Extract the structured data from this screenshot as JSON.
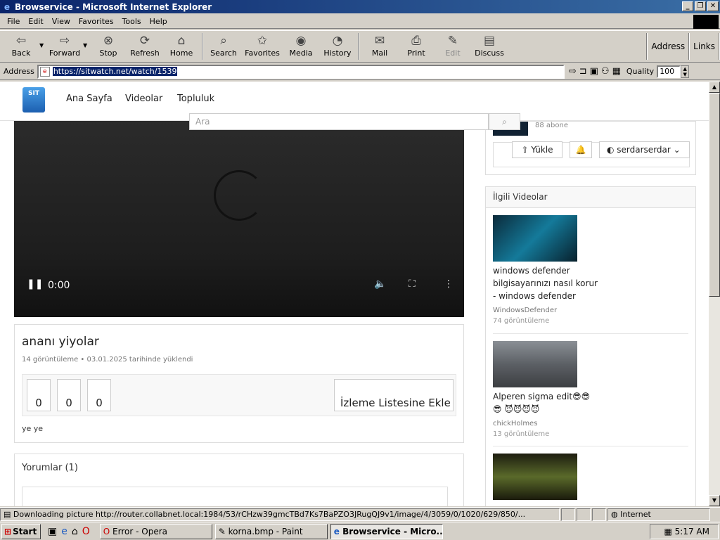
{
  "window": {
    "title": "Browservice - Microsoft Internet Explorer"
  },
  "menu": [
    "File",
    "Edit",
    "View",
    "Favorites",
    "Tools",
    "Help"
  ],
  "toolbar": {
    "back": "Back",
    "forward": "Forward",
    "stop": "Stop",
    "refresh": "Refresh",
    "home": "Home",
    "search": "Search",
    "favorites": "Favorites",
    "media": "Media",
    "history": "History",
    "mail": "Mail",
    "print": "Print",
    "edit": "Edit",
    "discuss": "Discuss",
    "address": "Address",
    "links": "Links"
  },
  "addressbar": {
    "label": "Address",
    "url": "https://sitwatch.net/watch/1539",
    "quality_label": "Quality",
    "quality_value": "100"
  },
  "site": {
    "logo": "SIT",
    "nav": [
      "Ana Sayfa",
      "Videolar",
      "Topluluk"
    ],
    "search_placeholder": "Ara",
    "upload": "Yükle",
    "username": "serdarserdar",
    "subscribers": "88 abone"
  },
  "video": {
    "time": "0:00",
    "title": "ananı yiyolar",
    "meta": "14 görüntüleme • 03.01.2025 tarihinde yüklendi",
    "counts": [
      "0",
      "0",
      "0"
    ],
    "watchlist": "İzleme Listesine Ekle",
    "description": "ye ye",
    "comments": "Yorumlar (1)"
  },
  "related": {
    "heading": "İlgili Videolar",
    "items": [
      {
        "title": "windows defender bilgisayarınızı nasıl korur - windows defender",
        "channel": "WindowsDefender",
        "views": "74 görüntüleme"
      },
      {
        "title": "Alperen sigma edit😎😎😎 😈😈😈😈",
        "channel": "chickHolmes",
        "views": "13 görüntüleme"
      }
    ]
  },
  "status": {
    "text": "Downloading picture http://router.collabnet.local:1984/53/rCHzw39gmcTBd7Ks7BaPZO3JRugQJ9v1/image/4/3059/0/1020/629/850/...",
    "zone": "Internet"
  },
  "taskbar": {
    "start": "Start",
    "tasks": [
      "Error - Opera",
      "korna.bmp - Paint",
      "Browservice - Micro..."
    ],
    "clock": "5:17 AM"
  }
}
